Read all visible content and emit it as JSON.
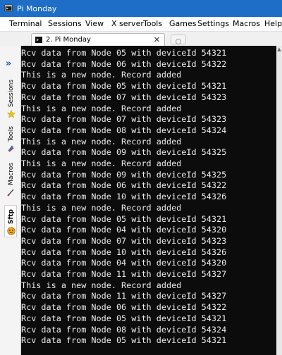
{
  "window": {
    "title": "Pi Monday"
  },
  "menu": [
    "Terminal",
    "Sessions",
    "View",
    "X server",
    "Tools",
    "Games",
    "Settings",
    "Macros",
    "Help"
  ],
  "tab": {
    "label": "2. Pi Monday"
  },
  "sidebar": {
    "tabs": [
      "Sessions",
      "Tools",
      "Macros",
      "Sftp"
    ]
  },
  "terminal": {
    "lines": [
      "Rcv data from Node 05 with deviceId 54321",
      "Rcv data from Node 06 with deviceId 54322",
      "This is a new node. Record added",
      "Rcv data from Node 05 with deviceId 54321",
      "Rcv data from Node 07 with deviceId 54323",
      "This is a new node. Record added",
      "Rcv data from Node 07 with deviceId 54323",
      "Rcv data from Node 08 with deviceId 54324",
      "This is a new node. Record added",
      "Rcv data from Node 09 with deviceId 54325",
      "This is a new node. Record added",
      "Rcv data from Node 09 with deviceId 54325",
      "Rcv data from Node 06 with deviceId 54322",
      "Rcv data from Node 10 with deviceId 54326",
      "This is a new node. Record added",
      "Rcv data from Node 05 with deviceId 54321",
      "Rcv data from Node 04 with deviceId 54320",
      "Rcv data from Node 07 with deviceId 54323",
      "Rcv data from Node 10 with deviceId 54326",
      "Rcv data from Node 04 with deviceId 54320",
      "Rcv data from Node 11 with deviceId 54327",
      "This is a new node. Record added",
      "Rcv data from Node 11 with deviceId 54327",
      "Rcv data from Node 06 with deviceId 54322",
      "Rcv data from Node 05 with deviceId 54321",
      "Rcv data from Node 08 with deviceId 54324",
      "Rcv data from Node 05 with deviceId 54321"
    ]
  },
  "colors": {
    "titlebar": "#1e6ec8",
    "terminal_bg": "#0c0c0c",
    "terminal_fg": "#ececec"
  }
}
